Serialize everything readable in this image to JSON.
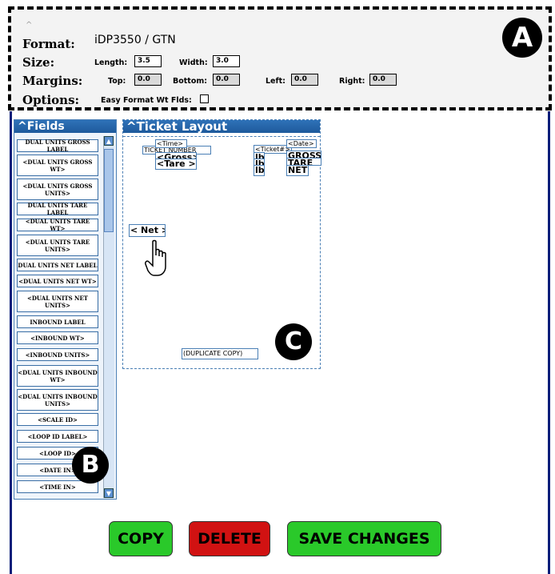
{
  "settings": {
    "format_label": "Format:",
    "format_value": "iDP3550 / GTN",
    "size_label": "Size:",
    "length_label": "Length:",
    "length_value": "3.5",
    "width_label": "Width:",
    "width_value": "3.0",
    "margins_label": "Margins:",
    "top_label": "Top:",
    "top_value": "0.0",
    "bottom_label": "Bottom:",
    "bottom_value": "0.0",
    "left_label": "Left:",
    "left_value": "0.0",
    "right_label": "Right:",
    "right_value": "0.0",
    "options_label": "Options:",
    "easy_format_label": "Easy Format Wt Flds:",
    "easy_format_checked": false
  },
  "badges": {
    "a": "A",
    "b": "B",
    "c": "C"
  },
  "fields_panel": {
    "title": "Fields",
    "items": [
      "DUAL UNITS GROSS LABEL",
      "<DUAL UNITS GROSS WT>",
      "<DUAL UNITS GROSS UNITS>",
      "DUAL UNITS TARE LABEL",
      "<DUAL UNITS TARE WT>",
      "<DUAL UNITS TARE UNITS>",
      "DUAL UNITS NET LABEL",
      "<DUAL UNITS NET WT>",
      "<DUAL UNITS NET UNITS>",
      "INBOUND LABEL",
      "<INBOUND WT>",
      "<INBOUND UNITS>",
      "<DUAL UNITS INBOUND WT>",
      "<DUAL UNITS INBOUND UNITS>",
      "<SCALE ID>",
      "<LOOP ID LABEL>",
      "<LOOP ID>",
      "<DATE IN>",
      "<TIME IN>"
    ]
  },
  "ticket_panel": {
    "title": "Ticket Layout",
    "fields": {
      "ticket_number": "TICKET NUMBER",
      "time": "<Time>",
      "gross": "<Gross>",
      "tare": "<Tare >",
      "ticket_hash": "<Ticket#>",
      "date": "<Date>",
      "lb1": "lb",
      "lb2": "lb",
      "lb3": "lb",
      "gross_label": "GROSS",
      "tare_label": "TARE",
      "net_label": "NET",
      "net": "< Net >",
      "duplicate": "(DUPLICATE COPY)"
    }
  },
  "actions": {
    "copy": "COPY",
    "delete": "DELETE",
    "save": "SAVE CHANGES"
  },
  "colors": {
    "frame": "#0b1e7a",
    "header": "#1e5a9c",
    "green": "#2ac92a",
    "red": "#d11212"
  }
}
